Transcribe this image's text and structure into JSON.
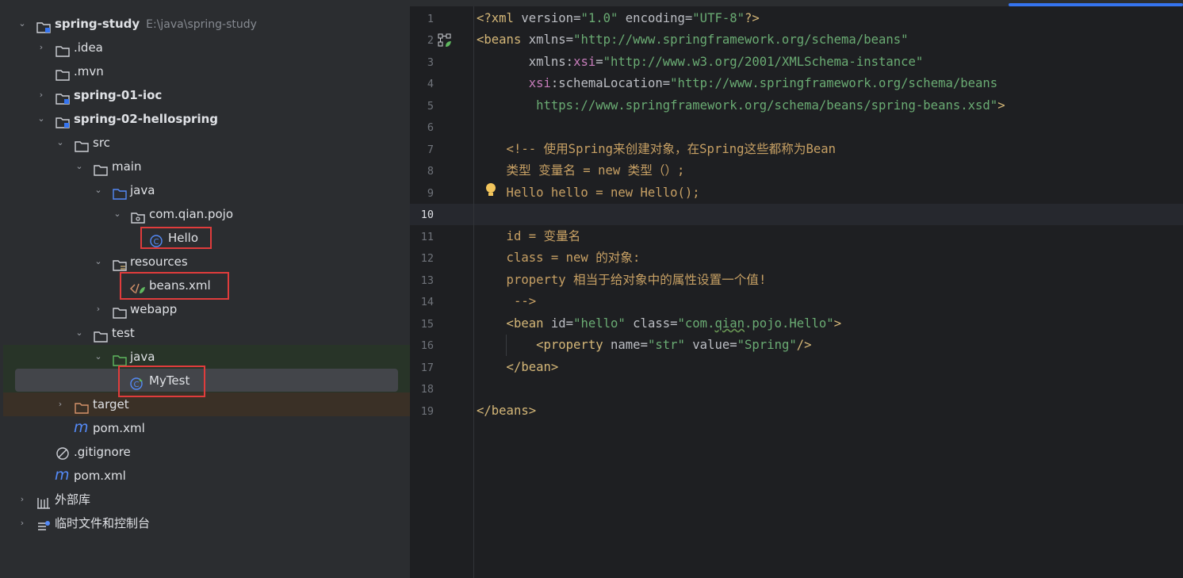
{
  "tree": {
    "rows": [
      {
        "name": "spring-study",
        "path": "E:\\java\\spring-study",
        "bold": true
      },
      {
        "name": ".idea"
      },
      {
        "name": ".mvn"
      },
      {
        "name": "spring-01-ioc",
        "bold": true
      },
      {
        "name": "spring-02-hellospring",
        "bold": true
      },
      {
        "name": "src"
      },
      {
        "name": "main"
      },
      {
        "name": "java"
      },
      {
        "name": "com.qian.pojo"
      },
      {
        "name": "Hello"
      },
      {
        "name": "resources"
      },
      {
        "name": "beans.xml"
      },
      {
        "name": "webapp"
      },
      {
        "name": "test"
      },
      {
        "name": "java"
      },
      {
        "name": "MyTest"
      },
      {
        "name": "target"
      },
      {
        "name": "pom.xml"
      },
      {
        "name": ".gitignore"
      },
      {
        "name": "pom.xml"
      },
      {
        "name": "外部库"
      },
      {
        "name": "临时文件和控制台"
      }
    ]
  },
  "editor": {
    "line_numbers": [
      "1",
      "2",
      "3",
      "4",
      "5",
      "6",
      "7",
      "8",
      "9",
      "10",
      "11",
      "12",
      "13",
      "14",
      "15",
      "16",
      "17",
      "18",
      "19"
    ],
    "current_line": "10",
    "code": {
      "l1": {
        "a": "<?xml ",
        "b": "version",
        "c": "=",
        "d": "\"1.0\"",
        "e": " encoding",
        "f": "=",
        "g": "\"UTF-8\"",
        "h": "?>"
      },
      "l2": {
        "a": "<beans ",
        "b": "xmlns",
        "c": "=",
        "d": "\"http://www.springframework.org/schema/beans\""
      },
      "l3": {
        "a": "       xmlns:",
        "b": "xsi",
        "c": "=",
        "d": "\"http://www.w3.org/2001/XMLSchema-instance\""
      },
      "l4": {
        "a": "       ",
        "b": "xsi",
        ":": ":",
        "c": "schemaLocation",
        "d": "=",
        "e": "\"http://www.springframework.org/schema/beans"
      },
      "l5": {
        "a": "        https://www.springframework.org/schema/beans/spring-beans.xsd\"",
        "b": ">"
      },
      "l7": "    <!-- 使用Spring来创建对象，在Spring这些都称为Bean",
      "l8": "    类型 变量名 = new 类型（）;",
      "l9": "    Hello hello = new Hello();",
      "l11": "    id = 变量名",
      "l12": "    class = new 的对象:",
      "l13": "    property 相当于给对象中的属性设置一个值!",
      "l14": "     -->",
      "l15": {
        "a": "    <bean ",
        "b": "id",
        "c": "=",
        "d": "\"hello\"",
        "e": " class",
        "f": "=",
        "g": "\"com.",
        "h": "qian",
        "i": ".pojo.Hello\"",
        "j": ">"
      },
      "l16": {
        "a": "        <property ",
        "b": "name",
        "c": "=",
        "d": "\"str\"",
        "e": " value",
        "f": "=",
        "g": "\"Spring\"",
        "h": "/>"
      },
      "l17": "    </bean>",
      "l19": "</beans>"
    }
  },
  "colors": {
    "accent": "#3574f0",
    "highlight_box": "#e03c3c"
  }
}
